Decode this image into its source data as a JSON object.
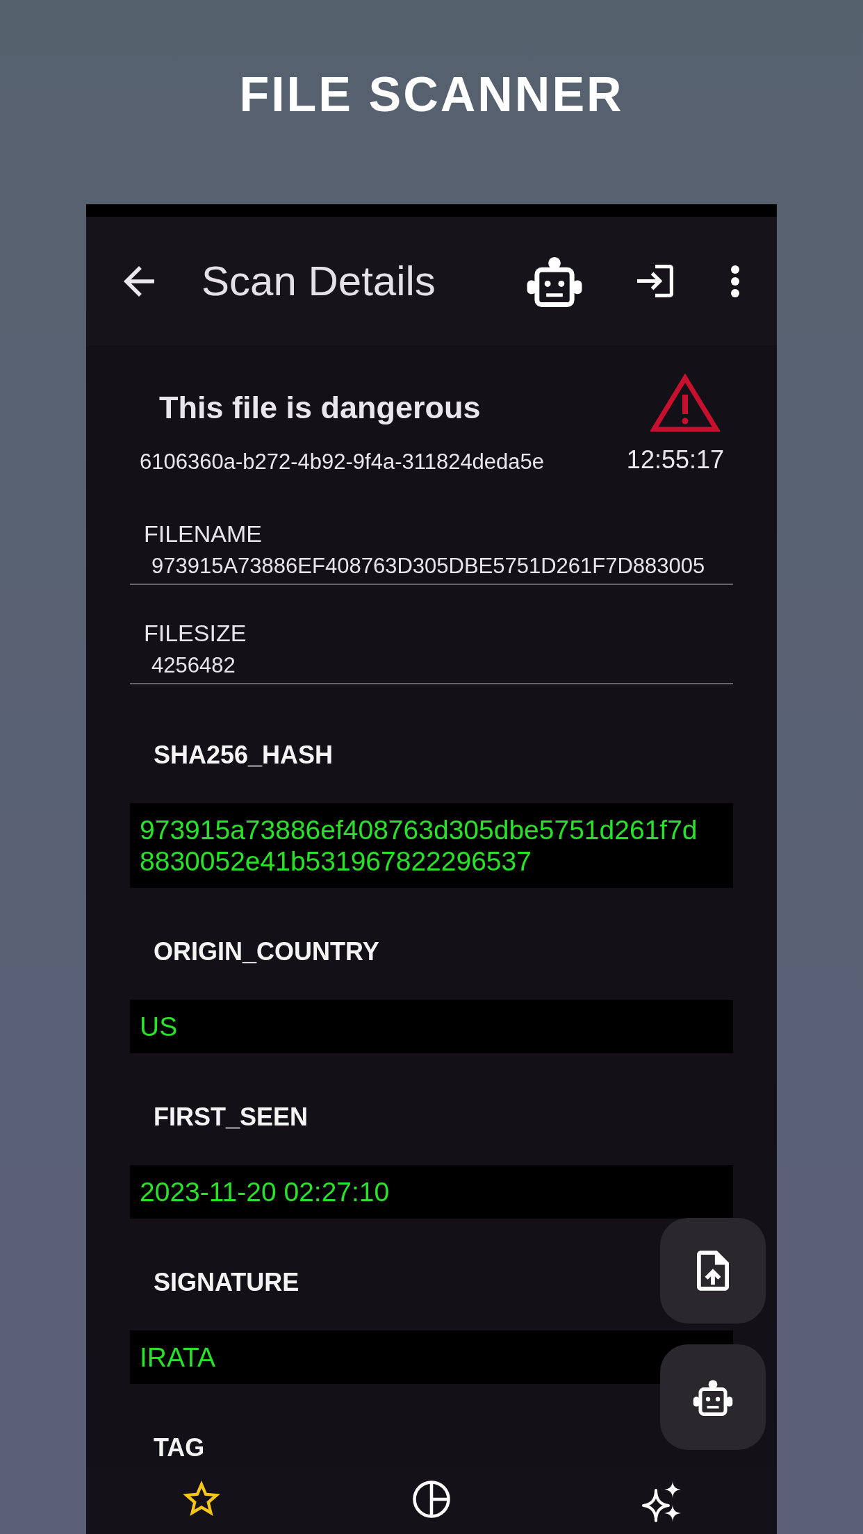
{
  "page_title": "FILE SCANNER",
  "app_bar": {
    "title": "Scan Details"
  },
  "result": {
    "heading": "This file is dangerous",
    "scan_id": "6106360a-b272-4b92-9f4a-311824deda5e",
    "time": "12:55:17"
  },
  "fields": [
    {
      "label": "FILENAME",
      "value": "973915A73886EF408763D305DBE5751D261F7D883005"
    },
    {
      "label": "FILESIZE",
      "value": "4256482"
    }
  ],
  "details": [
    {
      "label": "SHA256_HASH",
      "value": "973915a73886ef408763d305dbe5751d261f7d8830052e41b531967822296537"
    },
    {
      "label": "ORIGIN_COUNTRY",
      "value": "US"
    },
    {
      "label": "FIRST_SEEN",
      "value": "2023-11-20 02:27:10"
    },
    {
      "label": "SIGNATURE",
      "value": "IRATA"
    },
    {
      "label": "TAG"
    }
  ],
  "bottom_nav": [
    {
      "selected": true
    },
    {
      "selected": false
    },
    {
      "selected": false
    }
  ]
}
